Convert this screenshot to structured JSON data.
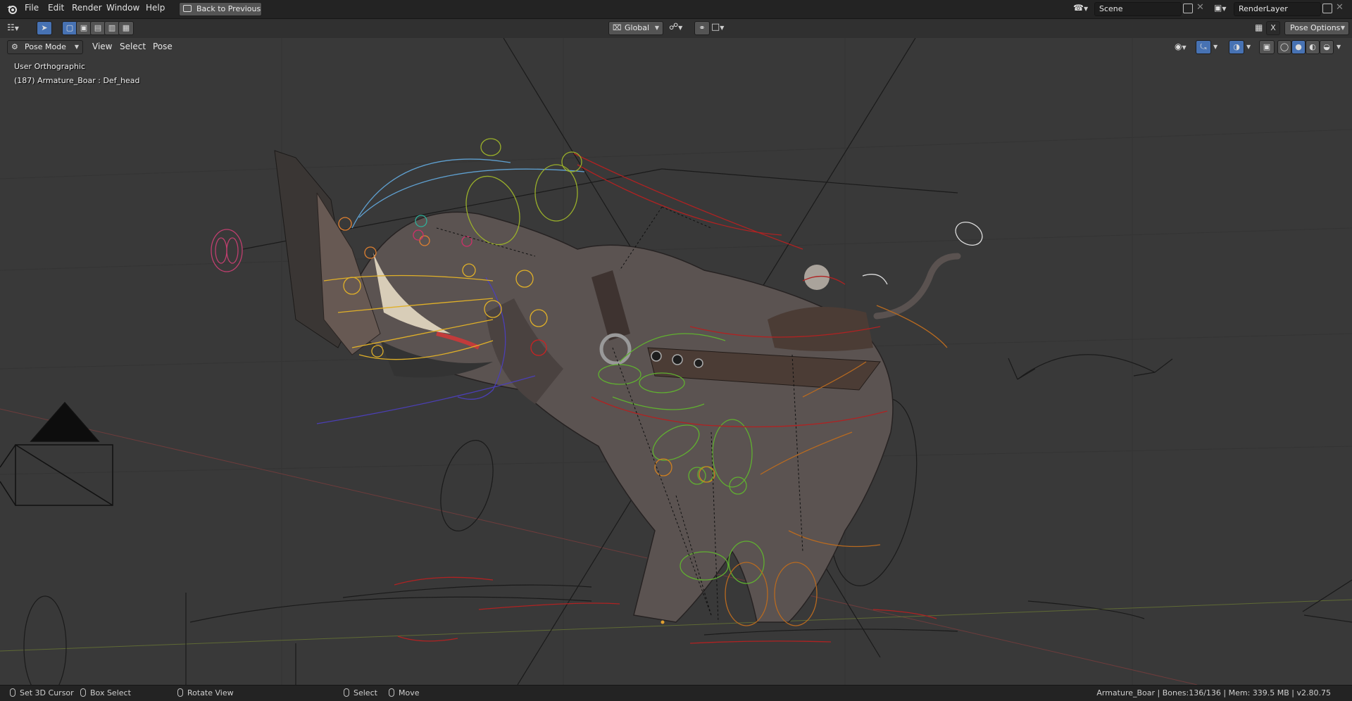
{
  "menubar": {
    "items": [
      "File",
      "Edit",
      "Render",
      "Window",
      "Help"
    ],
    "back_button": "Back to Previous",
    "scene_field": "Scene",
    "renderlayer_field": "RenderLayer"
  },
  "toolbar": {
    "orientation": "Global",
    "pose_options": "Pose Options",
    "x_label": "X"
  },
  "viewport_header": {
    "mode": "Pose Mode",
    "menus": [
      "View",
      "Select",
      "Pose"
    ]
  },
  "viewport": {
    "view_name": "User Orthographic",
    "active_info": "(187) Armature_Boar : Def_head"
  },
  "statusbar": {
    "set_cursor": "Set 3D Cursor",
    "box_select": "Box Select",
    "rotate_view": "Rotate View",
    "select": "Select",
    "move": "Move",
    "info": "Armature_Boar | Bones:136/136 | Mem: 339.5 MB | v2.80.75"
  },
  "colors": {
    "accent": "#4772b3",
    "header_bg": "#232323",
    "viewport_bg": "#393939"
  },
  "icons": [
    "blender-logo-icon",
    "editor-type-icon",
    "select-tool-icon",
    "select-box-icon",
    "select-extend-icon",
    "select-subtract-icon",
    "select-invert-icon",
    "select-intersect-icon",
    "back-icon",
    "scene-icon",
    "new-scene-icon",
    "close-icon",
    "renderlayer-icon",
    "transform-orientation-icon",
    "pivot-icon",
    "snap-icon",
    "proportional-icon",
    "visibility-icon",
    "gizmo-icon",
    "overlay-icon",
    "xray-icon",
    "wireframe-shading-icon",
    "solid-shading-icon",
    "material-shading-icon",
    "rendered-shading-icon",
    "mouse-left-icon",
    "mouse-middle-icon",
    "mouse-right-icon"
  ]
}
